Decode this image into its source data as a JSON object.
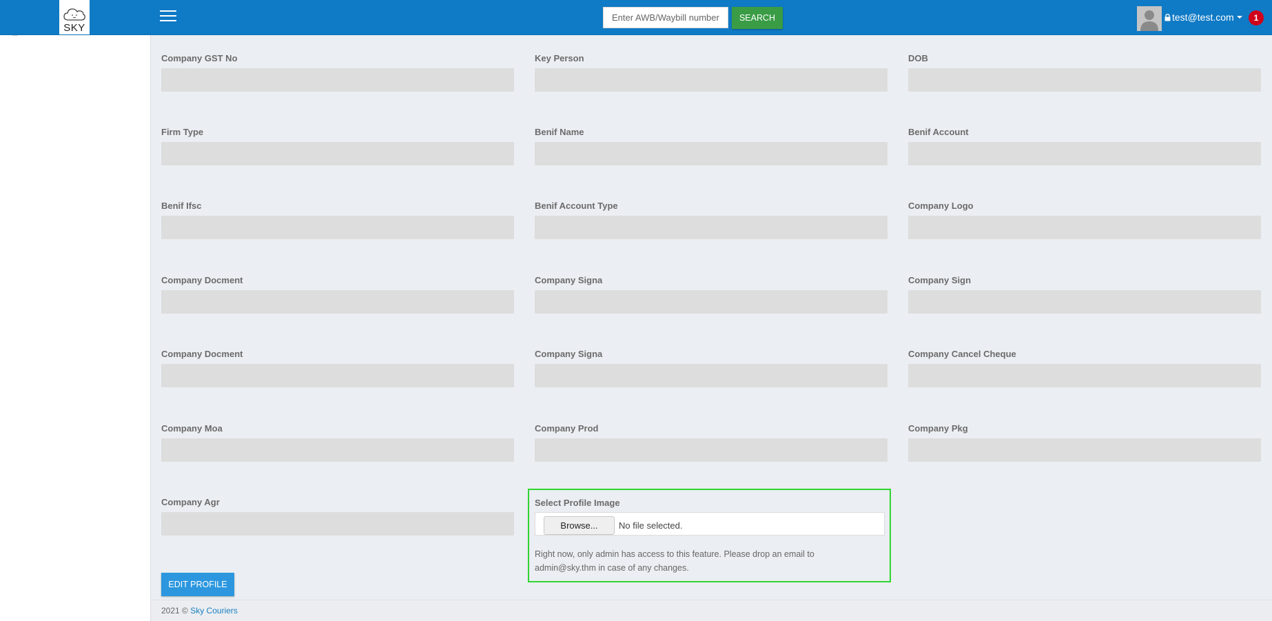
{
  "header": {
    "logo_text": "SKY",
    "search": {
      "placeholder": "Enter AWB/Waybill number",
      "value": ""
    },
    "search_button": "SEARCH",
    "user_email": "test@test.com",
    "notification_count": "1"
  },
  "form": {
    "fields": [
      "Company GST No",
      "Key Person",
      "DOB",
      "Firm Type",
      "Benif Name",
      "Benif Account",
      "Benif Ifsc",
      "Benif Account Type",
      "Company Logo",
      "Company Docment",
      "Company Signa",
      "Company Sign",
      "Company Docment",
      "Company Signa",
      "Company Cancel Cheque",
      "Company Moa",
      "Company Prod",
      "Company Pkg",
      "Company Agr"
    ],
    "upload": {
      "label": "Select Profile Image",
      "browse_label": "Browse...",
      "file_status": "No file selected.",
      "note": "Right now, only admin has access to this feature. Please drop an email to admin@sky.thm in case of any changes."
    },
    "edit_button": "EDIT PROFILE"
  },
  "footer": {
    "copyright": "2021 © ",
    "link": "Sky Couriers"
  },
  "colors": {
    "header": "#0f7ac5",
    "search_button": "#3a9c45",
    "edit_button": "#2c97de",
    "badge": "#d0021b",
    "highlight": "#2ed52e"
  }
}
